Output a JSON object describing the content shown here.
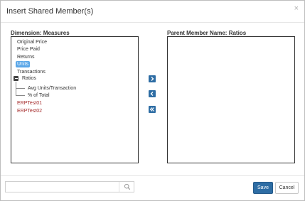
{
  "dialog": {
    "title": "Insert Shared Member(s)",
    "close_glyph": "×"
  },
  "left_panel": {
    "label": "Dimension: Measures",
    "items": [
      {
        "label": "Original Price",
        "type": "leaf"
      },
      {
        "label": "Price Paid",
        "type": "leaf"
      },
      {
        "label": "Returns",
        "type": "leaf"
      },
      {
        "label": "Units",
        "type": "leaf",
        "selected": true
      },
      {
        "label": "Transactions",
        "type": "leaf"
      },
      {
        "label": "Ratios",
        "type": "parent",
        "expanded": true
      },
      {
        "label": "Avg Units/Transaction",
        "type": "child"
      },
      {
        "label": "% of Total",
        "type": "child"
      },
      {
        "label": "ERPTest01",
        "type": "leaf",
        "color": "#a52a2a"
      },
      {
        "label": "ERPTest02",
        "type": "leaf",
        "color": "#a52a2a"
      }
    ]
  },
  "right_panel": {
    "label": "Parent Member Name: Ratios"
  },
  "move_buttons": {
    "add_icon": "chevron-right-icon",
    "remove_icon": "chevron-left-icon",
    "remove_all_icon": "double-chevron-left-icon"
  },
  "footer": {
    "search_placeholder": "",
    "search_value": "",
    "search_icon": "magnifier-icon",
    "save_label": "Save",
    "cancel_label": "Cancel"
  },
  "colors": {
    "accent": "#2e6da4",
    "selected_bg": "#5ba7e8",
    "red_item": "#a52a2a"
  }
}
